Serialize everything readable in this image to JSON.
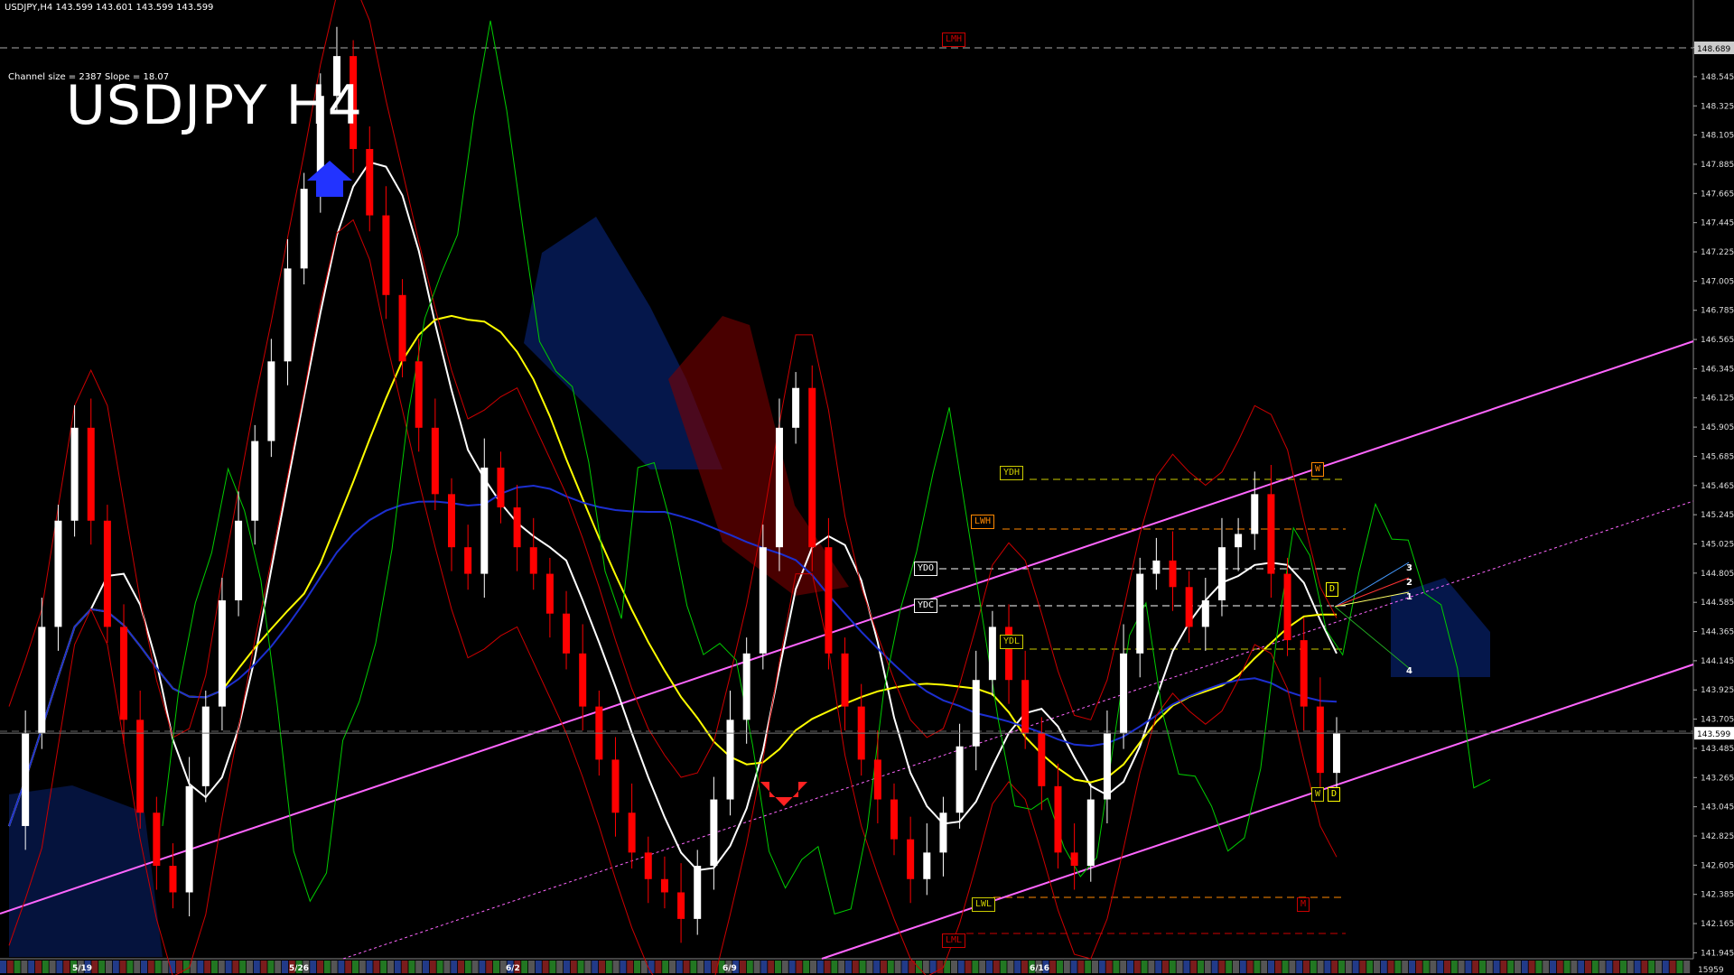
{
  "header": {
    "symbol_line": "USDJPY,H4  143.599 143.601 143.599 143.599",
    "channel_info": "Channel size = 2387 Slope = 18.07",
    "big_title": "USDJPY H4"
  },
  "colors": {
    "background": "#000000",
    "bull": "#ffffff",
    "bear": "#ff0000",
    "channel": "#ff66ff",
    "ma_white": "#ffffff",
    "ma_yellow": "#ffff00",
    "ma_blue": "#1c2fd0",
    "bands": "#cc0000",
    "chikou": "#00cc00"
  },
  "levels": [
    {
      "label": "LMH",
      "color": "#cc0000"
    },
    {
      "label": "YDH",
      "color": "#cccc00"
    },
    {
      "label": "LWH",
      "color": "#ff8800"
    },
    {
      "label": "YDO",
      "color": "#ffffff"
    },
    {
      "label": "YDC",
      "color": "#ffffff"
    },
    {
      "label": "YDL",
      "color": "#cccc00"
    },
    {
      "label": "LWL",
      "color": "#cccc00"
    },
    {
      "label": "LML",
      "color": "#cc0000"
    }
  ],
  "markers": {
    "W_top": "W",
    "D_right": "D",
    "W_low": "W",
    "D_low": "D",
    "M_low": "M"
  },
  "fan_labels": [
    "3",
    "2",
    "1",
    "4"
  ],
  "last_price_tag": "143.599",
  "top_price_tag": "148.689",
  "bottom_corner": "15959",
  "chart_data": {
    "type": "candlestick",
    "symbol": "USDJPY",
    "timeframe": "H4",
    "ylim": [
      141.9,
      149.0
    ],
    "y_ticks": [
      141.945,
      142.165,
      142.385,
      142.605,
      142.825,
      143.045,
      143.265,
      143.485,
      143.705,
      143.925,
      144.145,
      144.365,
      144.585,
      144.805,
      145.025,
      145.245,
      145.465,
      145.685,
      145.905,
      146.125,
      146.345,
      146.565,
      146.785,
      147.005,
      147.225,
      147.445,
      147.665,
      147.885,
      148.105,
      148.325,
      148.545,
      148.765
    ],
    "x_labels": [
      "5/19",
      "5/26",
      "6/2",
      "6/9",
      "6/16"
    ],
    "last_price": 143.599,
    "ohlc_close_path": [
      142.9,
      143.6,
      144.4,
      145.2,
      145.9,
      145.2,
      144.4,
      143.7,
      143.0,
      142.6,
      142.4,
      143.2,
      143.8,
      144.6,
      145.2,
      145.8,
      146.4,
      147.1,
      147.7,
      148.4,
      148.7,
      148.0,
      147.5,
      146.9,
      146.4,
      145.9,
      145.4,
      145.0,
      144.8,
      145.6,
      145.3,
      145.0,
      144.8,
      144.5,
      144.2,
      143.8,
      143.4,
      143.0,
      142.7,
      142.5,
      142.4,
      142.2,
      142.6,
      143.1,
      143.7,
      144.2,
      145.0,
      145.9,
      146.2,
      145.0,
      144.2,
      143.8,
      143.4,
      143.1,
      142.8,
      142.5,
      142.7,
      143.0,
      143.5,
      144.0,
      144.4,
      144.0,
      143.6,
      143.2,
      142.7,
      142.6,
      143.1,
      143.6,
      144.2,
      144.8,
      144.9,
      144.7,
      144.4,
      144.6,
      145.0,
      145.1,
      145.4,
      144.8,
      144.3,
      143.8,
      143.3,
      143.6
    ]
  }
}
